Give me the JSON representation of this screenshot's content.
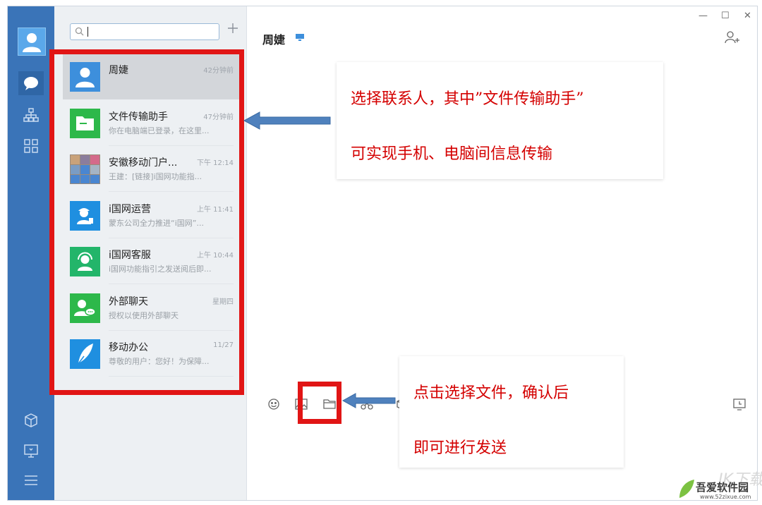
{
  "chat_title": "周婕",
  "window_controls": {
    "minimize": "—",
    "maximize": "☐",
    "close": "✕"
  },
  "contacts": [
    {
      "name": "周婕",
      "time": "42分钟前",
      "preview": "",
      "avatar_color": "#3d8fdc",
      "icon": "person-icon",
      "active": true
    },
    {
      "name": "文件传输助手",
      "time": "47分钟前",
      "preview": "你在电脑端已登录，在这里...",
      "avatar_color": "#2db84a",
      "icon": "folder-icon",
      "active": false
    },
    {
      "name": "安徽移动门户...",
      "time": "下午 12:14",
      "preview": "王建：[链接]i国网功能指...",
      "avatar_color": "#9a8a7a",
      "icon": "group-avatar-icon",
      "active": false
    },
    {
      "name": "i国网运营",
      "time": "上午 11:41",
      "preview": "蒙东公司全力推进“i国网”...",
      "avatar_color": "#1f8fe0",
      "icon": "worker-icon",
      "active": false
    },
    {
      "name": "i国网客服",
      "time": "上午 10:44",
      "preview": "i国网功能指引之发送阅后即...",
      "avatar_color": "#23b56a",
      "icon": "headset-icon",
      "active": false
    },
    {
      "name": "外部聊天",
      "time": "星期四",
      "preview": "授权以使用外部聊天",
      "avatar_color": "#2db84a",
      "icon": "external-chat-icon",
      "active": false
    },
    {
      "name": "移动办公",
      "time": "11/27",
      "preview": "尊敬的用户：您好！为保障...",
      "avatar_color": "#1f8fe0",
      "icon": "feather-icon",
      "active": false
    }
  ],
  "annotations": {
    "contacts_line1": "选择联系人，其中”文件传输助手”",
    "contacts_line2": "可实现手机、电脑间信息传输",
    "file_line1": "点击选择文件，确认后",
    "file_line2": "即可进行发送"
  },
  "watermark": {
    "brand": "吾爱软件园",
    "url": "www.52zixue.com",
    "faded": "IK下载"
  },
  "colors": {
    "sidebar": "#3a74b8",
    "highlight": "#e11515",
    "annotation_text": "#d40000",
    "arrow": "#4f81bd"
  }
}
